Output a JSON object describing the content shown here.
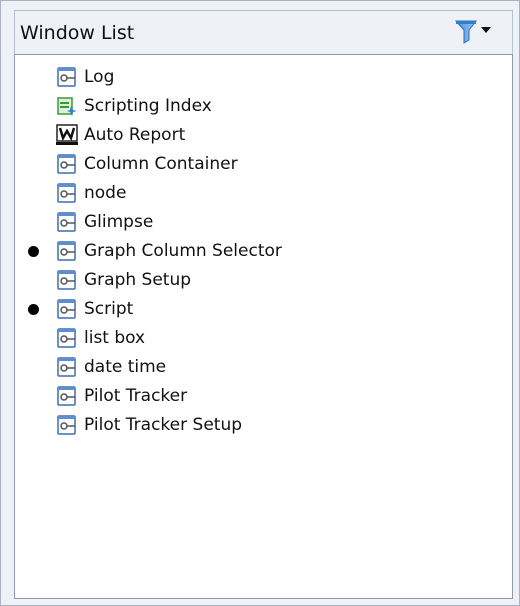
{
  "panel": {
    "title": "Window List",
    "filter_icon": "filter-funnel-icon"
  },
  "windows": [
    {
      "label": "Log",
      "icon": "window-icon",
      "active": false
    },
    {
      "label": "Scripting Index",
      "icon": "scripting-index-icon",
      "active": false
    },
    {
      "label": "Auto Report",
      "icon": "auto-report-icon",
      "active": false
    },
    {
      "label": "Column Container",
      "icon": "window-icon",
      "active": false
    },
    {
      "label": "node",
      "icon": "window-icon",
      "active": false
    },
    {
      "label": "Glimpse",
      "icon": "window-icon",
      "active": false
    },
    {
      "label": "Graph Column Selector",
      "icon": "window-icon",
      "active": true
    },
    {
      "label": "Graph Setup",
      "icon": "window-icon",
      "active": false
    },
    {
      "label": "Script",
      "icon": "window-icon",
      "active": true
    },
    {
      "label": "list box",
      "icon": "window-icon",
      "active": false
    },
    {
      "label": "date time",
      "icon": "window-icon",
      "active": false
    },
    {
      "label": "Pilot Tracker",
      "icon": "window-icon",
      "active": false
    },
    {
      "label": "Pilot Tracker Setup",
      "icon": "window-icon",
      "active": false
    }
  ],
  "colors": {
    "accent": "#2f7fd1",
    "scripting_green": "#3a9a3a"
  }
}
